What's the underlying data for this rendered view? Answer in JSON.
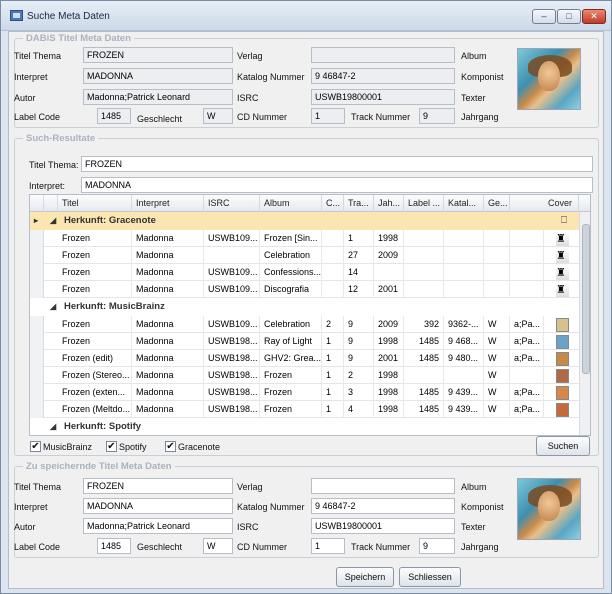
{
  "window": {
    "title": "Suche Meta Daten",
    "buttons": [
      "minimize",
      "maximize",
      "close"
    ]
  },
  "meta_top": {
    "legend": "DABiS Titel Meta Daten",
    "labels": {
      "titel_thema": "Titel Thema",
      "interpret": "Interpret",
      "autor": "Autor",
      "label_code": "Label Code",
      "geschlecht": "Geschlecht",
      "verlag": "Verlag",
      "katalog": "Katalog Nummer",
      "isrc": "ISRC",
      "cd_nummer": "CD Nummer",
      "track_nummer": "Track Nummer",
      "album": "Album",
      "komponist": "Komponist",
      "texter": "Texter",
      "jahrgang": "Jahrgang"
    },
    "values": {
      "titel_thema": "FROZEN",
      "interpret": "MADONNA",
      "autor": "Madonna;Patrick Leonard",
      "label_code": "1485",
      "geschlecht": "W",
      "verlag": "",
      "katalog": "9 46847-2",
      "isrc": "USWB19800001",
      "cd_nummer": "1",
      "track_nummer": "9"
    }
  },
  "search": {
    "legend": "Such-Resultate",
    "titel_label": "Titel Thema:",
    "titel_value": "FROZEN",
    "interpret_label": "Interpret:",
    "interpret_value": "MADONNA",
    "columns": [
      "Titel",
      "Interpret",
      "ISRC",
      "Album",
      "C...",
      "Tra...",
      "Jah...",
      "Label ...",
      "Katal...",
      "Ge...",
      "Cover"
    ],
    "groups": [
      {
        "name": "Herkunft: Gracenote",
        "rows": [
          [
            "Frozen",
            "Madonna",
            "USWB109...",
            "Frozen [Sin...",
            "",
            "1",
            "1998",
            "",
            "",
            "",
            ""
          ],
          [
            "Frozen",
            "Madonna",
            "",
            "Celebration",
            "",
            "27",
            "2009",
            "",
            "",
            "",
            ""
          ],
          [
            "Frozen",
            "Madonna",
            "USWB109...",
            "Confessions...",
            "",
            "14",
            "",
            "",
            "",
            "",
            ""
          ],
          [
            "Frozen",
            "Madonna",
            "USWB109...",
            "Discografia",
            "",
            "12",
            "2001",
            "",
            "",
            "",
            ""
          ]
        ]
      },
      {
        "name": "Herkunft: MusicBrainz",
        "rows": [
          [
            "Frozen",
            "Madonna",
            "USWB109...",
            "Celebration",
            "2",
            "9",
            "2009",
            "392",
            "9362-...",
            "W",
            "a;Pa..."
          ],
          [
            "Frozen",
            "Madonna",
            "USWB198...",
            "Ray of Light",
            "1",
            "9",
            "1998",
            "1485",
            "9 468...",
            "W",
            "a;Pa..."
          ],
          [
            "Frozen (edit)",
            "Madonna",
            "USWB198...",
            "GHV2: Grea...",
            "1",
            "9",
            "2001",
            "1485",
            "9 480...",
            "W",
            "a;Pa..."
          ],
          [
            "Frozen (Stereo...",
            "Madonna",
            "USWB198...",
            "Frozen",
            "1",
            "2",
            "1998",
            "",
            "",
            "W",
            ""
          ],
          [
            "Frozen (exten...",
            "Madonna",
            "USWB198...",
            "Frozen",
            "1",
            "3",
            "1998",
            "1485",
            "9 439...",
            "W",
            "a;Pa..."
          ],
          [
            "Frozen (Meltdo...",
            "Madonna",
            "USWB198...",
            "Frozen",
            "1",
            "4",
            "1998",
            "1485",
            "9 439...",
            "W",
            "a;Pa..."
          ]
        ]
      },
      {
        "name": "Herkunft: Spotify",
        "rows": []
      }
    ],
    "sources": [
      {
        "label": "MusicBrainz",
        "checked": true
      },
      {
        "label": "Spotify",
        "checked": true
      },
      {
        "label": "Gracenote",
        "checked": true
      }
    ],
    "search_button": "Suchen"
  },
  "meta_bottom": {
    "legend": "Zu speichernde Titel Meta Daten",
    "values": {
      "titel_thema": "FROZEN",
      "interpret": "MADONNA",
      "autor": "Madonna;Patrick Leonard",
      "label_code": "1485",
      "geschlecht": "W",
      "verlag": "",
      "katalog": "9 46847-2",
      "isrc": "USWB19800001",
      "cd_nummer": "1",
      "track_nummer": "9"
    }
  },
  "footer": {
    "save": "Speichern",
    "close": "Schliessen"
  }
}
